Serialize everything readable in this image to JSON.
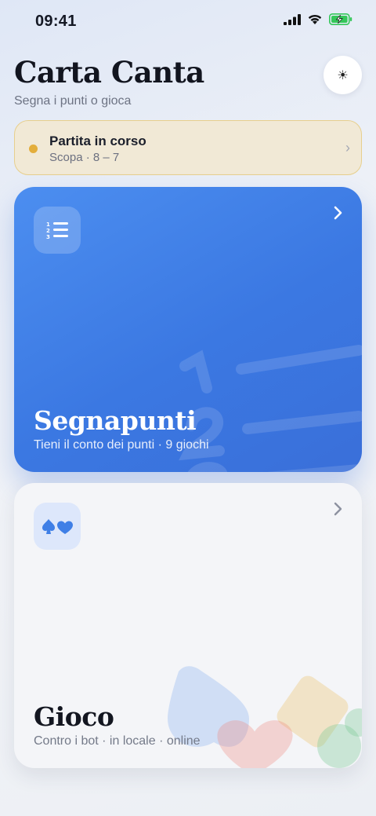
{
  "status_bar": {
    "time": "09:41"
  },
  "header": {
    "title": "Carta Canta",
    "subtitle": "Segna i punti o gioca",
    "theme_toggle_icon": "sun-icon"
  },
  "resume": {
    "title": "Partita in corso",
    "details": "Scopa · 8 – 7",
    "status_color": "#e3ae3c"
  },
  "cards": {
    "scorekeeper": {
      "title": "Segnapunti",
      "subtitle": "Tieni il conto dei punti · 9 giochi",
      "icon": "numbered-list-icon",
      "color": "#3f7fe6"
    },
    "game": {
      "title": "Gioco",
      "subtitle": "Contro i bot · in locale · online",
      "icon": "spade-heart-icon"
    }
  },
  "colors": {
    "accent": "#3f7fe6",
    "warning": "#e3ae3c",
    "battery": "#34c759"
  }
}
